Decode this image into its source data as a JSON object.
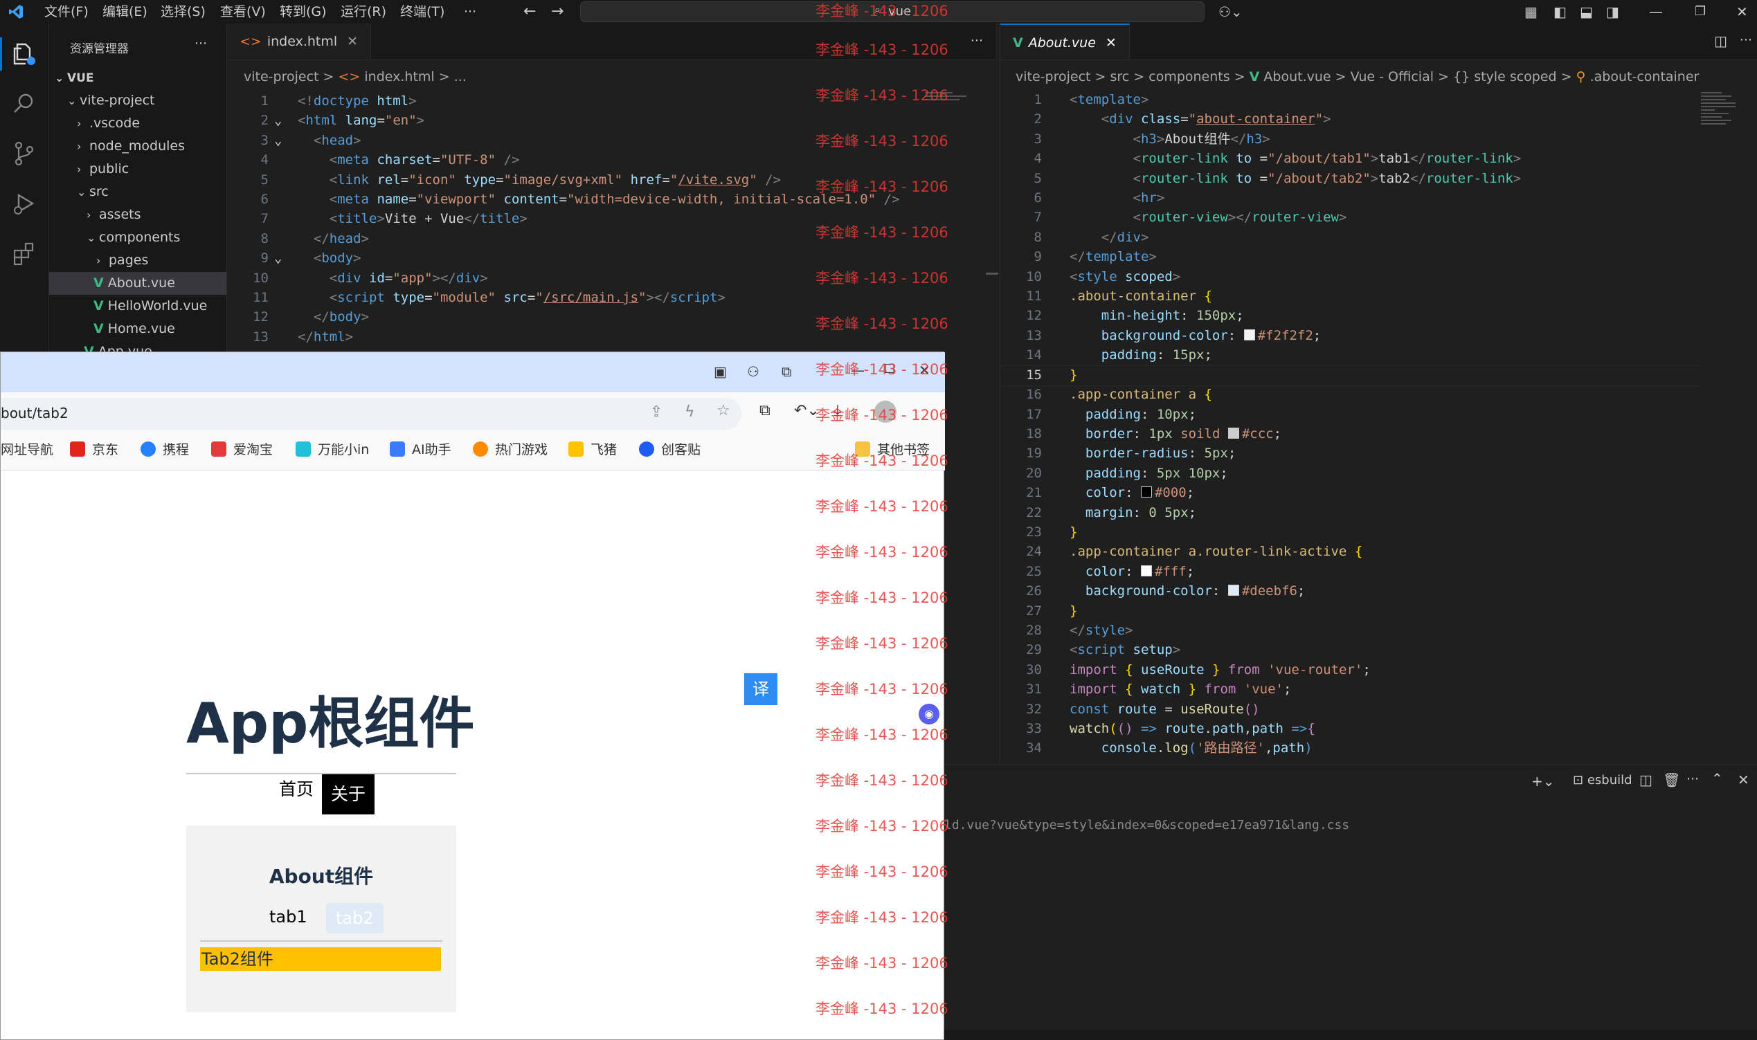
{
  "titlebar": {
    "menus": [
      "文件(F)",
      "编辑(E)",
      "选择(S)",
      "查看(V)",
      "转到(G)",
      "运行(R)",
      "终端(T)",
      "···"
    ],
    "search_text": "vue"
  },
  "sidebar": {
    "header": "资源管理器",
    "more": "···",
    "root": "VUE",
    "items": [
      {
        "label": "vite-project",
        "chev": "v"
      },
      {
        "label": ".vscode",
        "chev": ">"
      },
      {
        "label": "node_modules",
        "chev": ">"
      },
      {
        "label": "public",
        "chev": ">"
      },
      {
        "label": "src",
        "chev": "v"
      },
      {
        "label": "assets",
        "chev": ">"
      },
      {
        "label": "components",
        "chev": "v"
      },
      {
        "label": "pages",
        "chev": ">"
      },
      {
        "label": "About.vue",
        "chev": ""
      },
      {
        "label": "HelloWorld.vue",
        "chev": ""
      },
      {
        "label": "Home.vue",
        "chev": ""
      },
      {
        "label": "App.vue",
        "chev": ""
      }
    ]
  },
  "editor1": {
    "tab": "index.html",
    "breadcrumb": [
      "vite-project",
      ">",
      "index.html",
      ">",
      "..."
    ],
    "more": "···"
  },
  "editor2": {
    "tab": "About.vue",
    "breadcrumb": [
      "vite-project",
      ">",
      "src",
      ">",
      "components",
      ">",
      "About.vue",
      ">",
      "Vue - Official",
      ">",
      "{} style scoped",
      ">",
      ".about-container"
    ]
  },
  "panel": {
    "shell": "esbuild",
    "terminal_line": "ld.vue?vue&type=style&index=0&scoped=e17ea971&lang.css"
  },
  "browser": {
    "address": "bout/tab2",
    "bookmarks": [
      "网址导航",
      "京东",
      "携程",
      "爱淘宝",
      "万能小in",
      "AI助手",
      "热门游戏",
      "飞猪",
      "创客贴"
    ],
    "other_bookmarks": "其他书签",
    "translate_badge": "译",
    "page": {
      "title": "App根组件",
      "nav": [
        "首页",
        "关于"
      ],
      "about_title": "About组件",
      "tabs": [
        "tab1",
        "tab2"
      ],
      "tab2_content": "Tab2组件"
    }
  },
  "watermark": "李金峰 -143 - 1206",
  "colors": {
    "vscode_bg": "#1f1f1f",
    "accent": "#0078d4",
    "active_link": "#deebf6",
    "tab2_bg": "#ffc000"
  }
}
